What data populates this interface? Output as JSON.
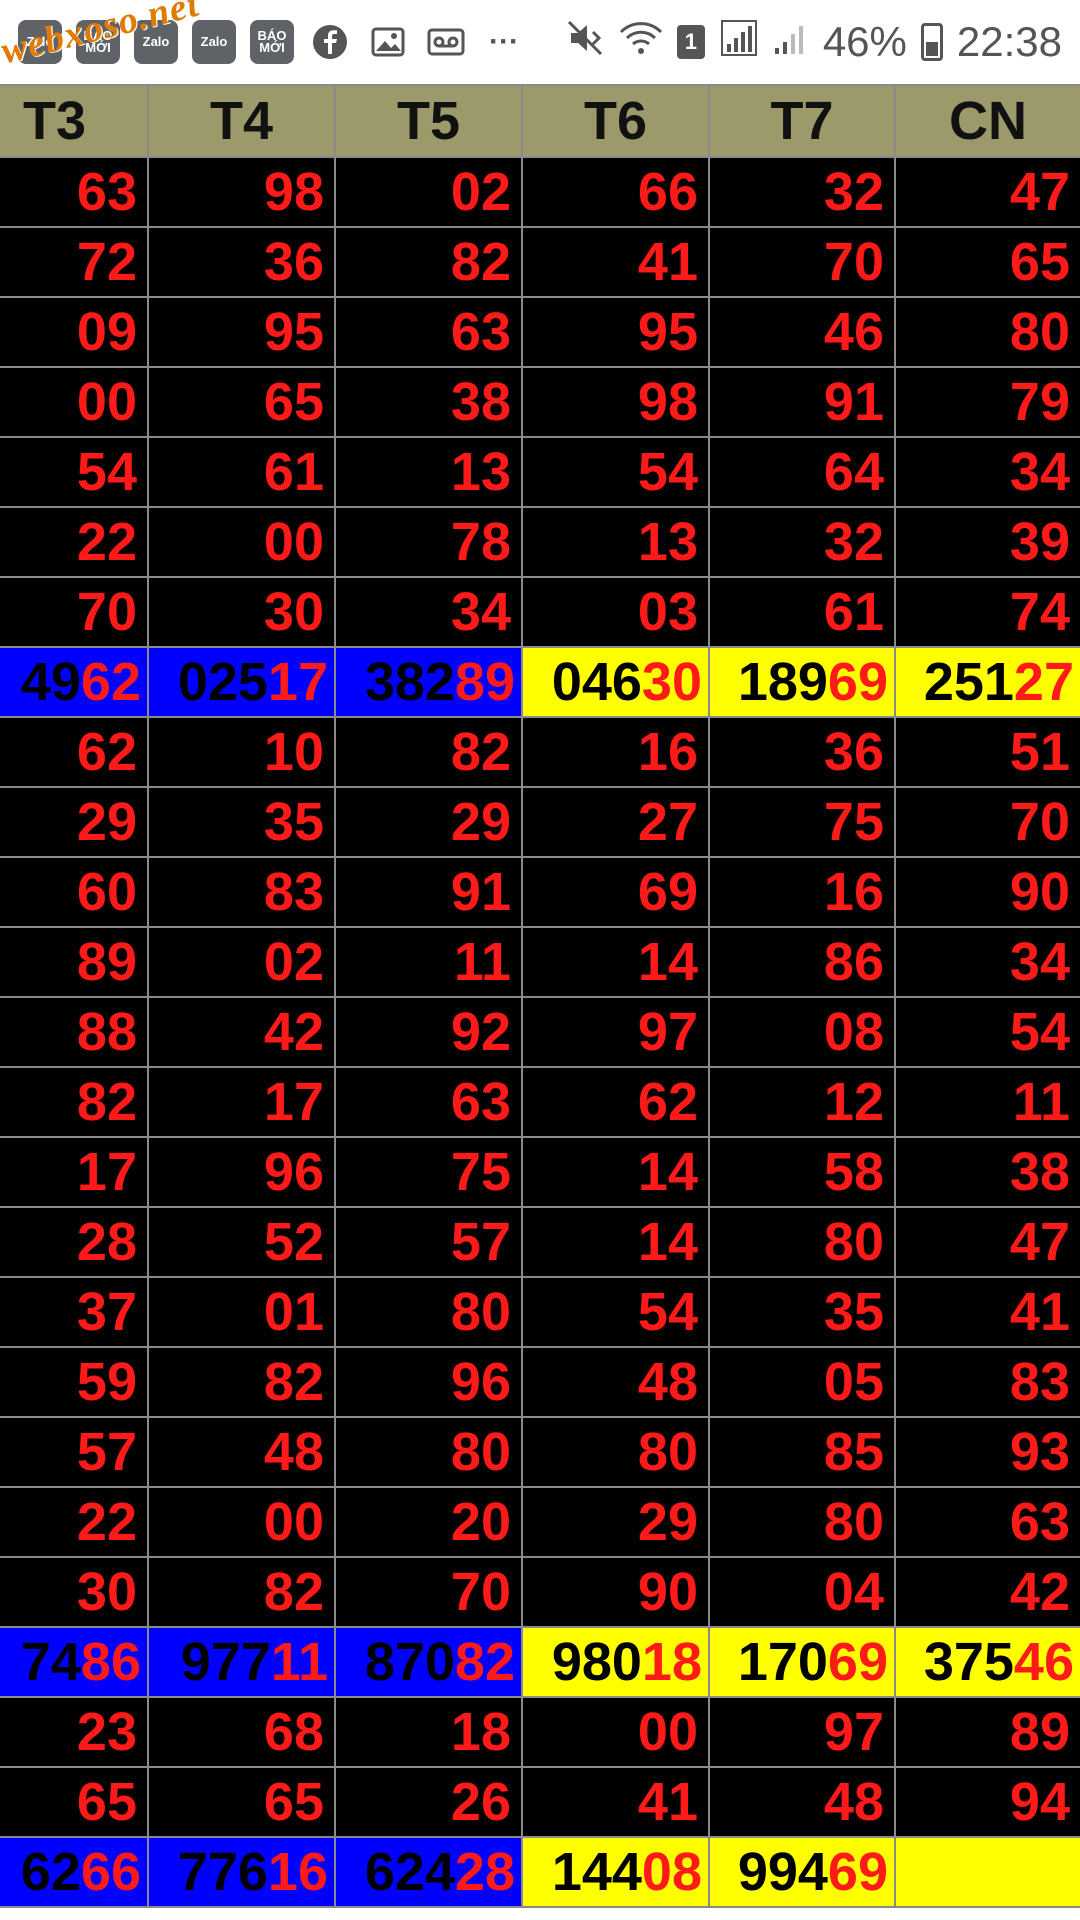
{
  "status_bar": {
    "app_icons": [
      "Zalo",
      "BÁO MỚI",
      "Zalo",
      "Zalo",
      "BÁO MỚI"
    ],
    "more": "···",
    "sim": "1",
    "battery": "46%",
    "time": "22:38"
  },
  "watermark": "webxoso.net",
  "table": {
    "headers": [
      "T3",
      "T4",
      "T5",
      "T6",
      "T7",
      "CN"
    ],
    "rows": [
      {
        "type": "num",
        "cells": [
          "63",
          "98",
          "02",
          "66",
          "32",
          "47"
        ]
      },
      {
        "type": "num",
        "cells": [
          "72",
          "36",
          "82",
          "41",
          "70",
          "65"
        ]
      },
      {
        "type": "num",
        "cells": [
          "09",
          "95",
          "63",
          "95",
          "46",
          "80"
        ]
      },
      {
        "type": "num",
        "cells": [
          "00",
          "65",
          "38",
          "98",
          "91",
          "79"
        ]
      },
      {
        "type": "num",
        "cells": [
          "54",
          "61",
          "13",
          "54",
          "64",
          "34"
        ]
      },
      {
        "type": "num",
        "cells": [
          "22",
          "00",
          "78",
          "13",
          "32",
          "39"
        ]
      },
      {
        "type": "num",
        "cells": [
          "70",
          "30",
          "34",
          "03",
          "61",
          "74"
        ]
      },
      {
        "type": "hl",
        "cells": [
          {
            "bg": "blue",
            "pre": "49",
            "suf": "62"
          },
          {
            "bg": "blue",
            "pre": "025",
            "suf": "17"
          },
          {
            "bg": "blue",
            "pre": "382",
            "suf": "89"
          },
          {
            "bg": "yellow",
            "pre": "046",
            "suf": "30"
          },
          {
            "bg": "yellow",
            "pre": "189",
            "suf": "69"
          },
          {
            "bg": "yellow",
            "pre": "251",
            "suf": "27"
          }
        ]
      },
      {
        "type": "num",
        "cells": [
          "62",
          "10",
          "82",
          "16",
          "36",
          "51"
        ]
      },
      {
        "type": "num",
        "cells": [
          "29",
          "35",
          "29",
          "27",
          "75",
          "70"
        ]
      },
      {
        "type": "num",
        "cells": [
          "60",
          "83",
          "91",
          "69",
          "16",
          "90"
        ]
      },
      {
        "type": "num",
        "cells": [
          "89",
          "02",
          "11",
          "14",
          "86",
          "34"
        ]
      },
      {
        "type": "num",
        "cells": [
          "88",
          "42",
          "92",
          "97",
          "08",
          "54"
        ]
      },
      {
        "type": "num",
        "cells": [
          "82",
          "17",
          "63",
          "62",
          "12",
          "11"
        ]
      },
      {
        "type": "num",
        "cells": [
          "17",
          "96",
          "75",
          "14",
          "58",
          "38"
        ]
      },
      {
        "type": "num",
        "cells": [
          "28",
          "52",
          "57",
          "14",
          "80",
          "47"
        ]
      },
      {
        "type": "num",
        "cells": [
          "37",
          "01",
          "80",
          "54",
          "35",
          "41"
        ]
      },
      {
        "type": "num",
        "cells": [
          "59",
          "82",
          "96",
          "48",
          "05",
          "83"
        ]
      },
      {
        "type": "num",
        "cells": [
          "57",
          "48",
          "80",
          "80",
          "85",
          "93"
        ]
      },
      {
        "type": "num",
        "cells": [
          "22",
          "00",
          "20",
          "29",
          "80",
          "63"
        ]
      },
      {
        "type": "num",
        "cells": [
          "30",
          "82",
          "70",
          "90",
          "04",
          "42"
        ]
      },
      {
        "type": "hl",
        "cells": [
          {
            "bg": "blue",
            "pre": "74",
            "suf": "86"
          },
          {
            "bg": "blue",
            "pre": "977",
            "suf": "11"
          },
          {
            "bg": "blue",
            "pre": "870",
            "suf": "82"
          },
          {
            "bg": "yellow",
            "pre": "980",
            "suf": "18"
          },
          {
            "bg": "yellow",
            "pre": "170",
            "suf": "69"
          },
          {
            "bg": "yellow",
            "pre": "375",
            "suf": "46"
          }
        ]
      },
      {
        "type": "num",
        "cells": [
          "23",
          "68",
          "18",
          "00",
          "97",
          "89"
        ]
      },
      {
        "type": "num",
        "cells": [
          "65",
          "65",
          "26",
          "41",
          "48",
          "94"
        ]
      },
      {
        "type": "hl",
        "cells": [
          {
            "bg": "blue",
            "pre": "62",
            "suf": "66"
          },
          {
            "bg": "blue",
            "pre": "776",
            "suf": "16"
          },
          {
            "bg": "blue",
            "pre": "624",
            "suf": "28"
          },
          {
            "bg": "yellow",
            "pre": "144",
            "suf": "08"
          },
          {
            "bg": "yellow",
            "pre": "994",
            "suf": "69"
          },
          {
            "bg": "yellow",
            "pre": "",
            "suf": ""
          }
        ]
      }
    ]
  }
}
